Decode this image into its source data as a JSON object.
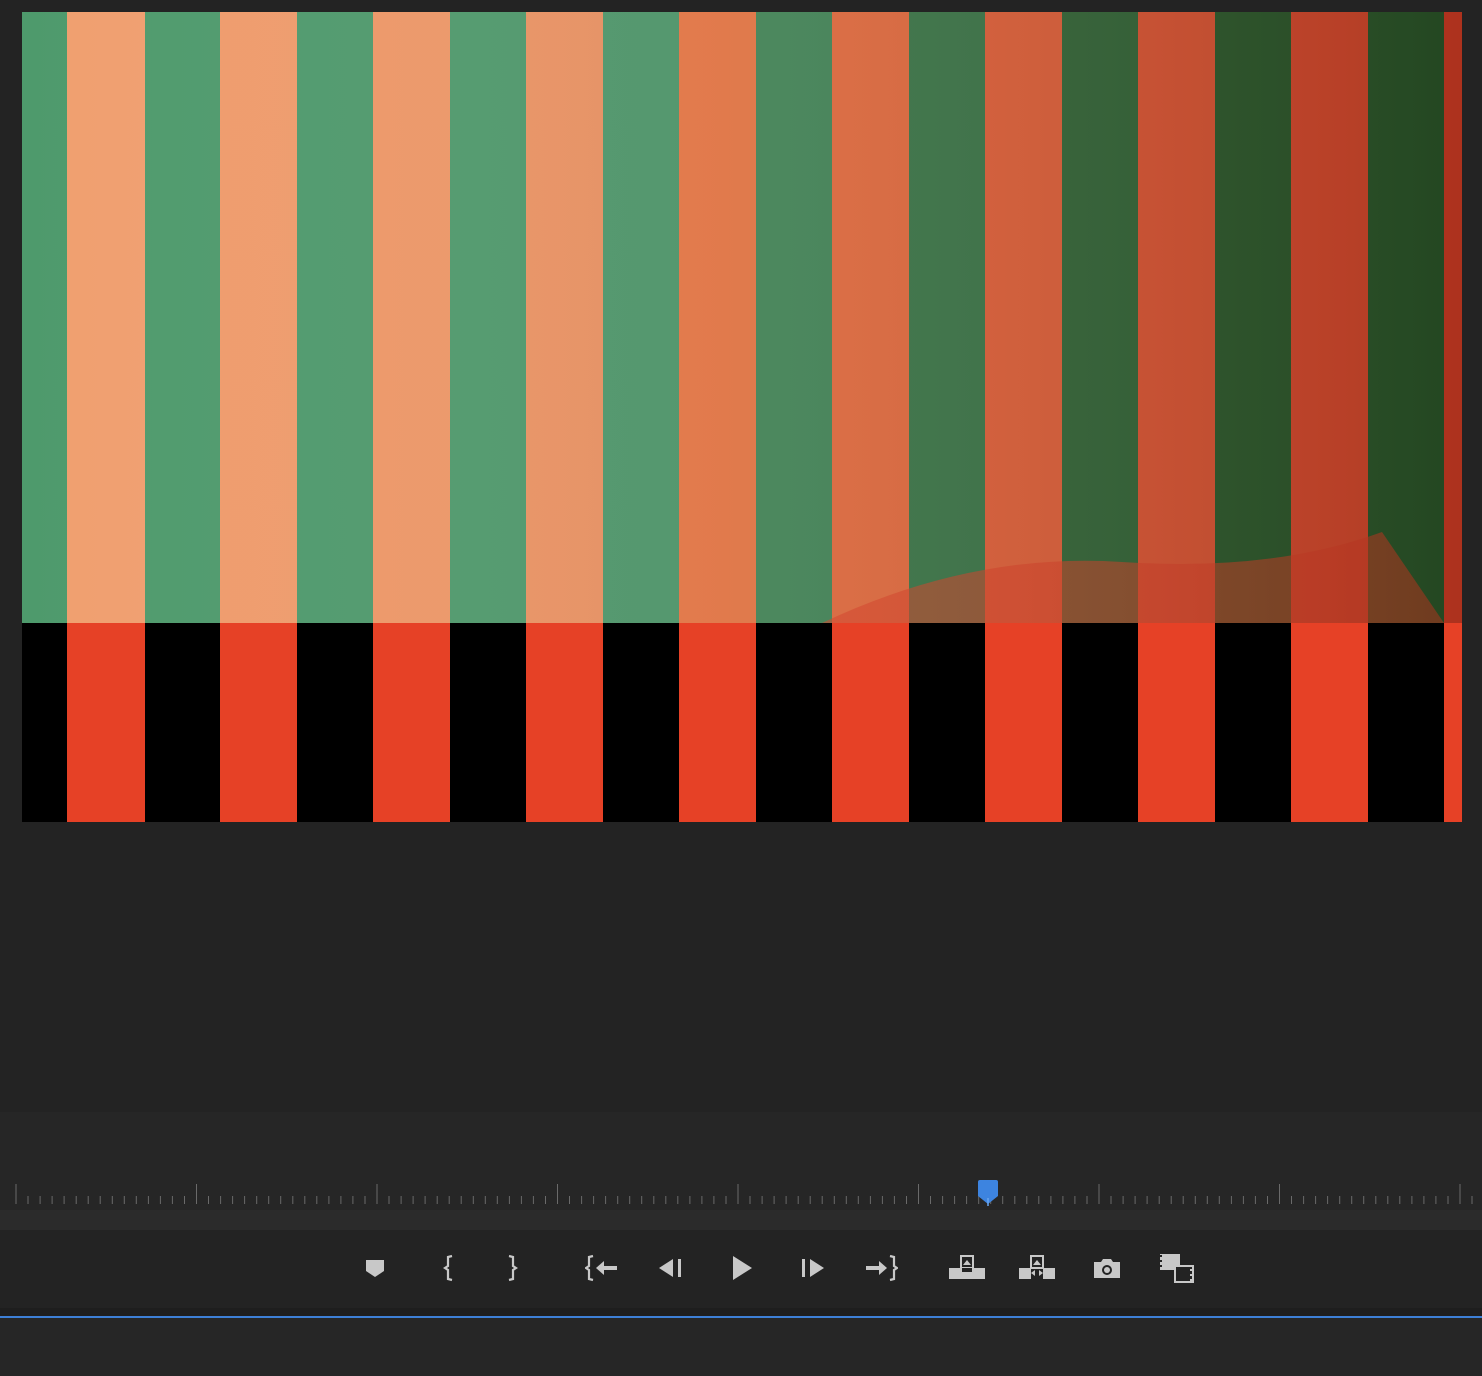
{
  "program_monitor": {
    "frame": {
      "image": "video-frame-stripes-icon",
      "stripe_colors": {
        "green": "#4e9a6c",
        "dark_green": "#2f5e2c",
        "salmon": "#f0a070",
        "orange": "#ee7a45",
        "red": "#e64126",
        "black": "#000000"
      }
    }
  },
  "timeline": {
    "playhead_color": "#3d84e0",
    "playhead_position": 0.667
  },
  "transport": {
    "buttons": [
      {
        "name": "add-marker-button",
        "icon": "marker-icon"
      },
      {
        "name": "mark-in-button",
        "icon": "mark-in-icon"
      },
      {
        "name": "mark-out-button",
        "icon": "mark-out-icon"
      },
      {
        "name": "go-to-in-button",
        "icon": "go-to-in-icon"
      },
      {
        "name": "step-back-button",
        "icon": "step-back-icon"
      },
      {
        "name": "play-button",
        "icon": "play-icon"
      },
      {
        "name": "step-forward-button",
        "icon": "step-forward-icon"
      },
      {
        "name": "go-to-out-button",
        "icon": "go-to-out-icon"
      },
      {
        "name": "lift-button",
        "icon": "lift-icon"
      },
      {
        "name": "extract-button",
        "icon": "extract-icon"
      },
      {
        "name": "export-frame-button",
        "icon": "camera-icon"
      },
      {
        "name": "comparison-view-button",
        "icon": "comparison-view-icon"
      }
    ],
    "icon_color": "#c8c8c8"
  },
  "accent_color": "#3d7fd6"
}
